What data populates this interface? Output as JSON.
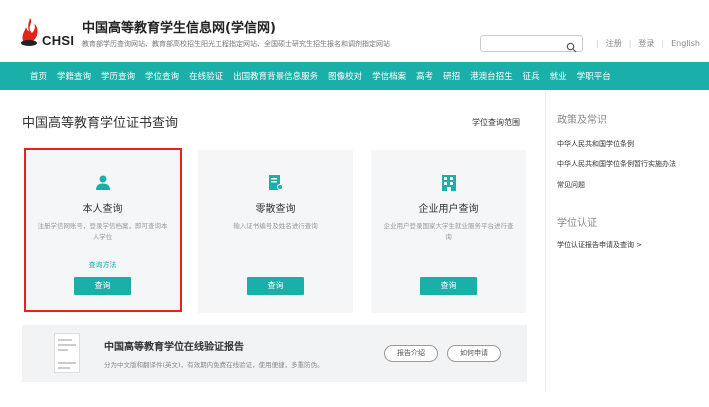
{
  "header": {
    "site_title": "中国高等教育学生信息网(学信网)",
    "site_subtitle": "教育部学历查询网站、教育部高校招生阳光工程指定网站、全国硕士研究生招生报名和调剂指定网站",
    "logo_text": "CHSI",
    "search_placeholder": "",
    "links": [
      "注册",
      "登录",
      "English"
    ]
  },
  "nav": {
    "items": [
      "首页",
      "学籍查询",
      "学历查询",
      "学位查询",
      "在线验证",
      "出国教育背景信息服务",
      "图像校对",
      "学信档案",
      "高考",
      "研招",
      "港澳台招生",
      "征兵",
      "就业",
      "学职平台"
    ]
  },
  "main": {
    "title": "中国高等教育学位证书查询",
    "range_link": "学位查询范围",
    "cards": [
      {
        "title": "本人查询",
        "desc": "注册学信网账号，登录学信档案，即可查询本人学位",
        "link": "查询方法",
        "button": "查询",
        "icon": "person-icon"
      },
      {
        "title": "零散查询",
        "desc": "输入证书编号及姓名进行查询",
        "link": "",
        "button": "查询",
        "icon": "document-icon"
      },
      {
        "title": "企业用户查询",
        "desc": "企业用户登录国家大学生就业服务平台进行查询",
        "link": "",
        "button": "查询",
        "icon": "building-icon"
      }
    ],
    "banner": {
      "title": "中国高等教育学位在线验证报告",
      "desc": "分为中文版和翻译件(英文)，有效期内免费在线验证，使用便捷，多重防伪。",
      "buttons": [
        "报告介绍",
        "如何申请"
      ]
    }
  },
  "sidebar": {
    "policy_heading": "政策及常识",
    "policy_links": [
      "中华人民共和国学位条例",
      "中华人民共和国学位条例暂行实施办法",
      "常见问题"
    ],
    "auth_heading": "学位认证",
    "auth_links": [
      "学位认证报告申请及查询 >"
    ]
  },
  "colors": {
    "accent": "#1ab0a9",
    "highlight": "#e1251b"
  }
}
